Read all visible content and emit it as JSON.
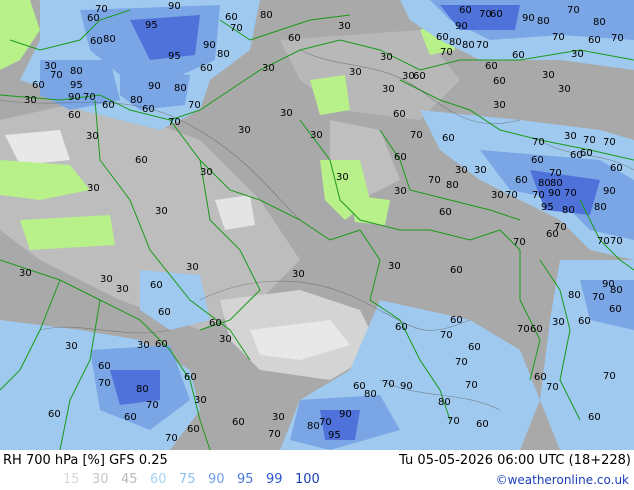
{
  "header": {
    "title_left": "RH 700 hPa [%] GFS 0.25",
    "title_right": "Tu 05-05-2026 06:00 UTC (18+228)",
    "credit": "©weatheronline.co.uk"
  },
  "legend": {
    "items": [
      {
        "label": "15",
        "color": "#d8d8d8"
      },
      {
        "label": "30",
        "color": "#c6c6c6"
      },
      {
        "label": "45",
        "color": "#b7b7b7"
      },
      {
        "label": "60",
        "color": "#a6d1f0"
      },
      {
        "label": "75",
        "color": "#8fbfec"
      },
      {
        "label": "90",
        "color": "#6f9ee8"
      },
      {
        "label": "95",
        "color": "#4a78e0"
      },
      {
        "label": "99",
        "color": "#2c55d6"
      },
      {
        "label": "100",
        "color": "#1c3fb8"
      }
    ]
  },
  "colors": {
    "background_gray": "#a9a9a9",
    "dry_light": "#e8e8e8",
    "green_zone": "#b8f08a",
    "blue_light": "#9fc9ee",
    "blue_mid": "#7aa6e6",
    "blue_dark": "#4e72d9",
    "border": "#1a9a1a"
  },
  "contour_labels": [
    "30",
    "60",
    "70",
    "80",
    "90",
    "95"
  ]
}
